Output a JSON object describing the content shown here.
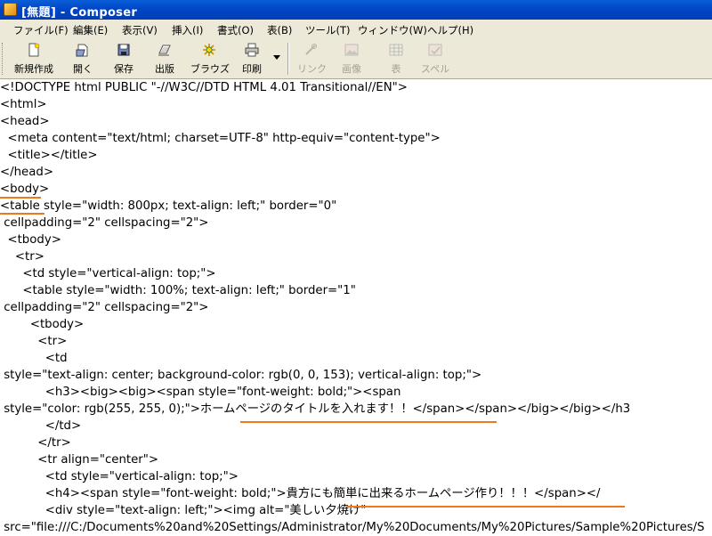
{
  "window": {
    "title": "[無題] - Composer"
  },
  "menu": [
    "ファイル(F)",
    "編集(E)",
    "表示(V)",
    "挿入(I)",
    "書式(O)",
    "表(B)",
    "ツール(T)",
    "ウィンドウ(W)",
    "ヘルプ(H)"
  ],
  "toolbar": {
    "new": "新規作成",
    "open": "開く",
    "save": "保存",
    "publish": "出版",
    "browse": "ブラウズ",
    "print": "印刷",
    "link": "リンク",
    "image": "画像",
    "table": "表",
    "spell": "スペル"
  },
  "source_lines": [
    "<!DOCTYPE html PUBLIC \"-//W3C//DTD HTML 4.01 Transitional//EN\">",
    "<html>",
    "<head>",
    "  <meta content=\"text/html; charset=UTF-8\" http-equiv=\"content-type\">",
    "  <title></title>",
    "</head>",
    "<body>",
    "<table style=\"width: 800px; text-align: left;\" border=\"0\"",
    " cellpadding=\"2\" cellspacing=\"2\">",
    "  <tbody>",
    "    <tr>",
    "      <td style=\"vertical-align: top;\">",
    "      <table style=\"width: 100%; text-align: left;\" border=\"1\"",
    " cellpadding=\"2\" cellspacing=\"2\">",
    "        <tbody>",
    "          <tr>",
    "            <td",
    " style=\"text-align: center; background-color: rgb(0, 0, 153); vertical-align: top;\">",
    "            <h3><big><big><span style=\"font-weight: bold;\"><span",
    " style=\"color: rgb(255, 255, 0);\">ホームページのタイトルを入れます！！</span></span></big></big></h3",
    "            </td>",
    "          </tr>",
    "          <tr align=\"center\">",
    "            <td style=\"vertical-align: top;\">",
    "            <h4><span style=\"font-weight: bold;\">貴方にも簡単に出来るホームページ作り！！！</span></",
    "            <div style=\"text-align: left;\"><img alt=\"美しい夕焼け\"",
    " src=\"file:///C:/Documents%20and%20Settings/Administrator/My%20Documents/My%20Pictures/Sample%20Pictures/S"
  ]
}
